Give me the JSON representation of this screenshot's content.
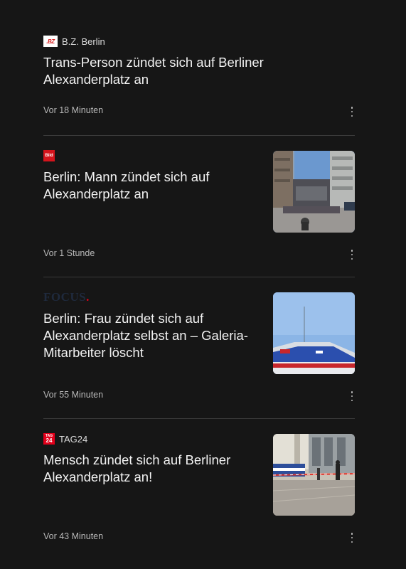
{
  "feed": {
    "items": [
      {
        "source": "B.Z. Berlin",
        "logo_text": ".BZ",
        "icon": "bz-logo-icon",
        "headline": "Trans-Person zündet sich auf Berliner Alexanderplatz an",
        "time": "Vor 18 Minuten",
        "has_thumbnail": false
      },
      {
        "source": "",
        "logo_text": "Bild",
        "icon": "bild-logo-icon",
        "headline": "Berlin: Mann zündet sich auf Alexanderplatz an",
        "time": "Vor 1 Stunde",
        "has_thumbnail": true,
        "thumbnail": "alexanderplatz-street-photo"
      },
      {
        "source": "",
        "logo_text": "FOCUS",
        "logo_dot": ".",
        "icon": "focus-logo-icon",
        "headline": "Berlin: Frau zündet sich auf Alexanderplatz selbst an – Galeria-Mitarbeiter löscht",
        "time": "Vor 55 Minuten",
        "has_thumbnail": true,
        "thumbnail": "police-car-sky-photo"
      },
      {
        "source": "TAG24",
        "logo_text_top": "TAG",
        "logo_text_bottom": "24",
        "icon": "tag24-logo-icon",
        "headline": "Mensch zündet sich auf Berliner Alexanderplatz an!",
        "time": "Vor 43 Minuten",
        "has_thumbnail": true,
        "thumbnail": "police-cordon-photo"
      }
    ]
  },
  "colors": {
    "background": "#161616",
    "divider": "#3a3a3a",
    "headline": "#f2f2f2",
    "meta": "#b8b8b8",
    "bild_red": "#d4141c",
    "tag24_red": "#e3001b",
    "focus_navy": "#1f2a3d"
  }
}
